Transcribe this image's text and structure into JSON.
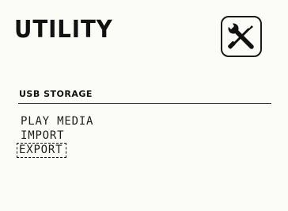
{
  "screen": {
    "title": "UTILITY",
    "title_icon": "tools-icon"
  },
  "section": {
    "header": "USB STORAGE"
  },
  "menu": {
    "items": [
      {
        "label": "PLAY MEDIA",
        "selected": false
      },
      {
        "label": "IMPORT",
        "selected": false
      },
      {
        "label": "EXPORT",
        "selected": true
      }
    ]
  },
  "colors": {
    "background": "#fbfbf7",
    "foreground": "#161616"
  }
}
